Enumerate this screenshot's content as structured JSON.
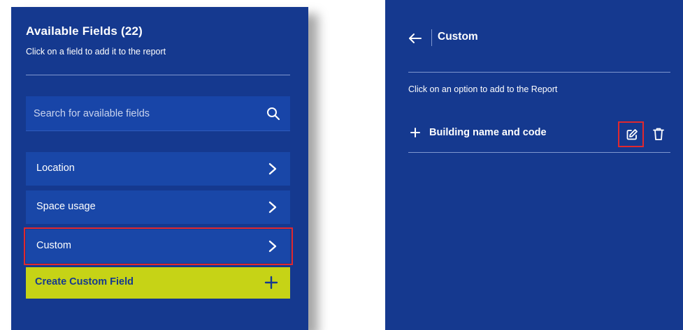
{
  "colors": {
    "panel_bg": "#15398f",
    "item_bg": "#1947a8",
    "accent_button": "#c6d316",
    "highlight": "#e1282e",
    "text": "#ffffff"
  },
  "left_panel": {
    "title": "Available Fields (22)",
    "subtitle": "Click on a field to add it to the report",
    "search": {
      "placeholder": "Search for available fields",
      "value": "",
      "icon": "search-icon"
    },
    "categories": [
      {
        "label": "Location",
        "icon": "chevron-right-icon"
      },
      {
        "label": "Space usage",
        "icon": "chevron-right-icon"
      },
      {
        "label": "Custom",
        "icon": "chevron-right-icon",
        "highlighted": true
      }
    ],
    "create_button": {
      "label": "Create Custom Field",
      "icon": "plus-icon"
    }
  },
  "right_panel": {
    "back_icon": "arrow-left-icon",
    "title": "Custom",
    "hint": "Click on an option to add to the Report",
    "options": [
      {
        "label": "Building name and code",
        "add_icon": "plus-icon",
        "edit_icon": "edit-icon",
        "delete_icon": "trash-icon",
        "edit_highlighted": true
      }
    ]
  }
}
